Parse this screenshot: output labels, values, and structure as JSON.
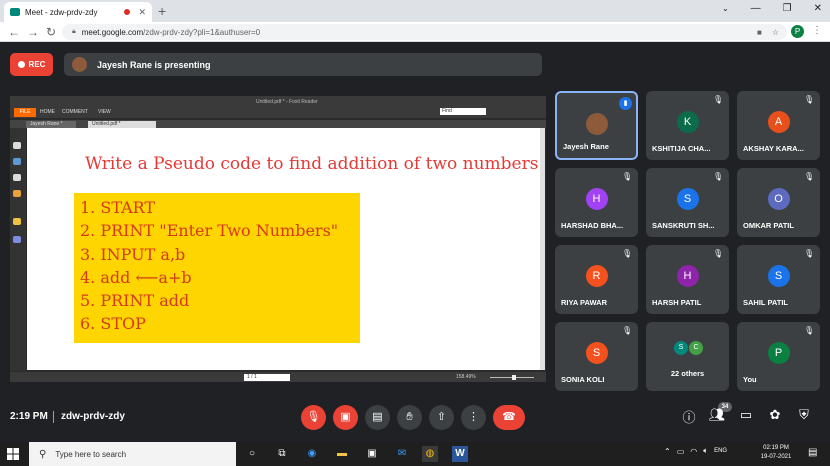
{
  "browser": {
    "tab_title": "Meet - zdw-prdv-zdy",
    "tab_close": "✕",
    "new_tab": "+",
    "url_host": "meet.google.com",
    "url_path": "/zdw-prdv-zdy?pli=1&authuser=0",
    "profile_initial": "P",
    "win_minimize": "—",
    "win_restore": "❐",
    "win_close": "✕"
  },
  "meet": {
    "rec_label": "REC",
    "presenting_text": "Jayesh Rane is presenting",
    "time": "2:19 PM",
    "meeting_code": "zdw-prdv-zdy",
    "participants_count": "34"
  },
  "pdf": {
    "title": "Untitled.pdf * - Foxit Reader",
    "file_tab": "FILE",
    "home_tab": "HOME",
    "comment_tab": "COMMENT",
    "view_tab": "VIEW",
    "search_value": "Find",
    "doc_tab_1": "Jayesh Rane *",
    "doc_tab_2": "Untitled.pdf *",
    "page_number": "1 / 1",
    "zoom": "158.49%",
    "slide_title": "Write a Pseudo code to find addition of two numbers",
    "steps": [
      "1. START",
      "2. PRINT \"Enter Two Numbers\"",
      "3. INPUT a,b",
      "4. add ⟵a+b",
      "5. PRINT add",
      "6. STOP"
    ]
  },
  "participants": [
    {
      "name": "Jayesh Rane",
      "initial": "",
      "color": "#8d5a3c",
      "speaking": true
    },
    {
      "name": "KSHITIJA CHA...",
      "initial": "K",
      "color": "#0b6b4a"
    },
    {
      "name": "AKSHAY KARA...",
      "initial": "A",
      "color": "#e8501b"
    },
    {
      "name": "HARSHAD BHA...",
      "initial": "H",
      "color": "#a142f4"
    },
    {
      "name": "SANSKRUTI SH...",
      "initial": "S",
      "color": "#1a73e8"
    },
    {
      "name": "OMKAR PATIL",
      "initial": "O",
      "color": "#5c6bc0"
    },
    {
      "name": "RIYA PAWAR",
      "initial": "R",
      "color": "#f4511e"
    },
    {
      "name": "HARSH PATIL",
      "initial": "H",
      "color": "#8e24aa"
    },
    {
      "name": "SAHIL PATIL",
      "initial": "S",
      "color": "#1a73e8"
    },
    {
      "name": "SONIA KOLI",
      "initial": "S",
      "color": "#f4511e"
    },
    {
      "name": "22 others",
      "initial": "S",
      "initial2": "C",
      "color": "#00897b",
      "color2": "#43a047"
    },
    {
      "name": "You",
      "initial": "P",
      "color": "#0b8043"
    }
  ],
  "taskbar": {
    "search_placeholder": "Type here to search",
    "lang": "ENG",
    "time": "02:19 PM",
    "date": "19-07-2021"
  },
  "colors": {
    "accent_red": "#ea4335",
    "slide_highlight": "#ffd500",
    "slide_text": "#d43a1a"
  }
}
